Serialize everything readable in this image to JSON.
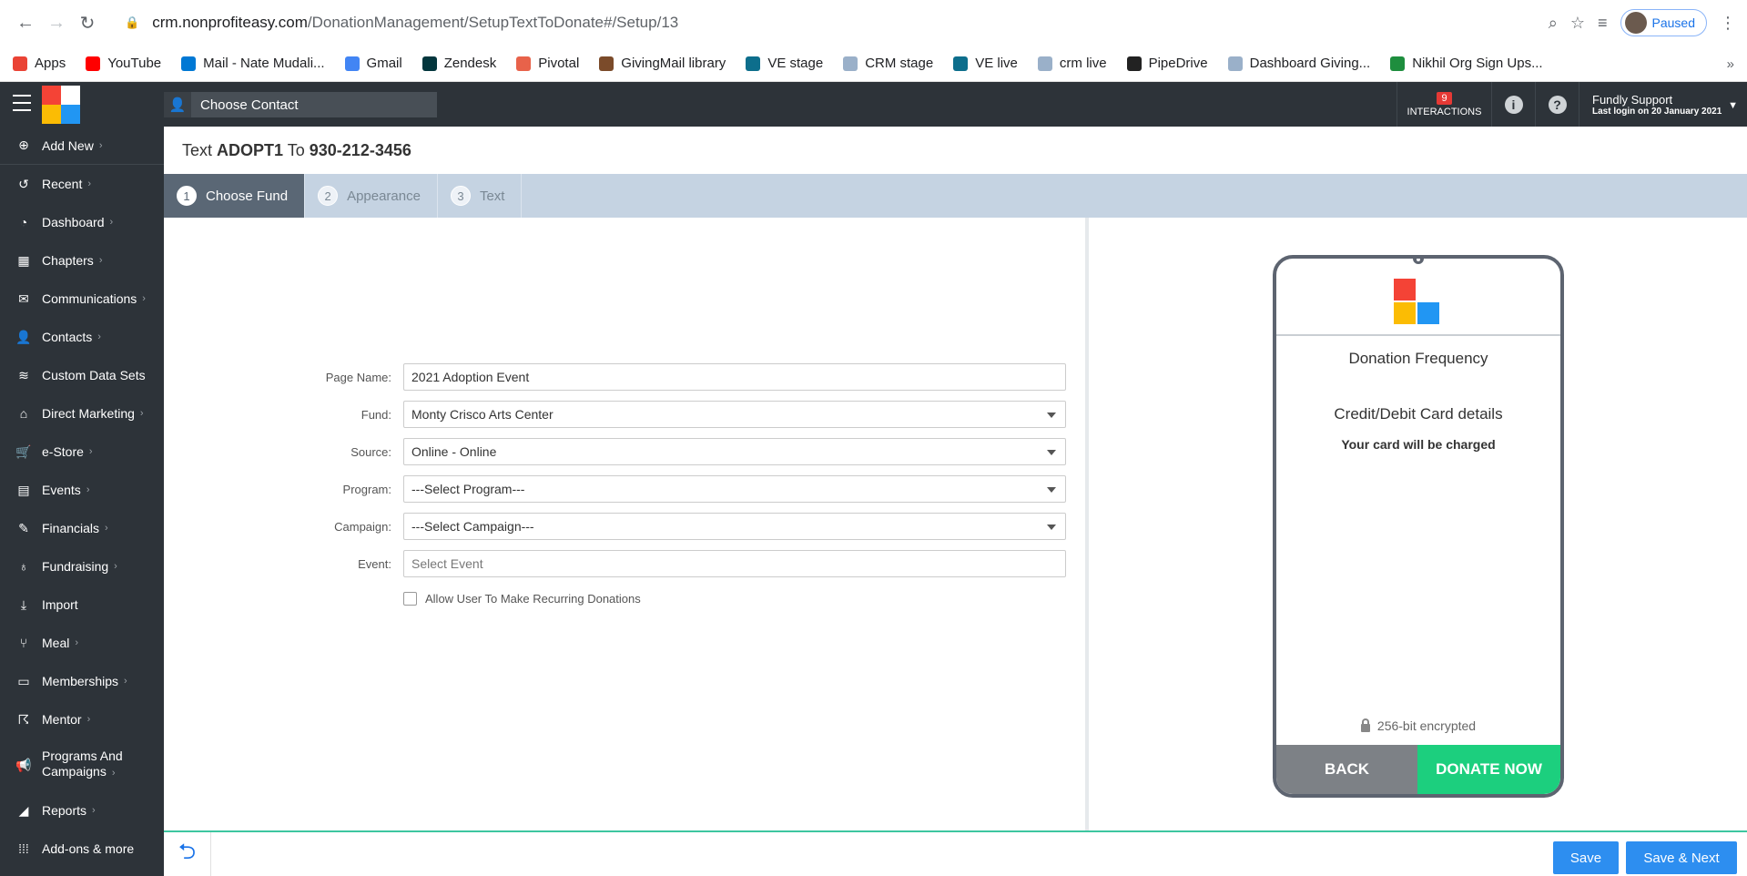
{
  "browser": {
    "url_host": "crm.nonprofiteasy.com",
    "url_path": "/DonationManagement/SetupTextToDonate#/Setup/13",
    "profile_status": "Paused"
  },
  "bookmarks": [
    {
      "label": "Apps",
      "color": "#ea4335"
    },
    {
      "label": "YouTube",
      "color": "#ff0000"
    },
    {
      "label": "Mail - Nate Mudali...",
      "color": "#0078d4"
    },
    {
      "label": "Gmail",
      "color": "#4285f4"
    },
    {
      "label": "Zendesk",
      "color": "#03363d"
    },
    {
      "label": "Pivotal",
      "color": "#e8624a"
    },
    {
      "label": "GivingMail library",
      "color": "#7b4b2a"
    },
    {
      "label": "VE stage",
      "color": "#0d6e8c"
    },
    {
      "label": "CRM stage",
      "color": "#9ab0c9"
    },
    {
      "label": "VE live",
      "color": "#0d6e8c"
    },
    {
      "label": "crm live",
      "color": "#9ab0c9"
    },
    {
      "label": "PipeDrive",
      "color": "#222222"
    },
    {
      "label": "Dashboard Giving...",
      "color": "#9ab0c9"
    },
    {
      "label": "Nikhil Org Sign Ups...",
      "color": "#1e8e3e"
    }
  ],
  "header": {
    "choose_contact": "Choose Contact",
    "interactions_count": "9",
    "interactions_label": "INTERACTIONS",
    "user_name": "Fundly Support",
    "last_login": "Last login on 20 January 2021"
  },
  "sidebar": {
    "items": [
      {
        "label": "Add New",
        "icon": "plus-circle-icon",
        "glyph": "⊕",
        "chevron": "›"
      },
      {
        "label": "Recent",
        "icon": "history-icon",
        "glyph": "↺",
        "chevron": "›"
      },
      {
        "label": "Dashboard",
        "icon": "dashboard-icon",
        "glyph": "◔",
        "chevron": "›"
      },
      {
        "label": "Chapters",
        "icon": "grid-icon",
        "glyph": "▦",
        "chevron": "›"
      },
      {
        "label": "Communications",
        "icon": "envelope-icon",
        "glyph": "✉",
        "chevron": "›"
      },
      {
        "label": "Contacts",
        "icon": "user-icon",
        "glyph": "👤",
        "chevron": "›"
      },
      {
        "label": "Custom Data Sets",
        "icon": "layers-icon",
        "glyph": "≋",
        "chevron": ""
      },
      {
        "label": "Direct Marketing",
        "icon": "bank-icon",
        "glyph": "⌂",
        "chevron": "›"
      },
      {
        "label": "e-Store",
        "icon": "cart-icon",
        "glyph": "🛒",
        "chevron": "›"
      },
      {
        "label": "Events",
        "icon": "calendar-icon",
        "glyph": "▤",
        "chevron": "›"
      },
      {
        "label": "Financials",
        "icon": "money-icon",
        "glyph": "✎",
        "chevron": "›"
      },
      {
        "label": "Fundraising",
        "icon": "moneybag-icon",
        "glyph": "♁",
        "chevron": "›"
      },
      {
        "label": "Import",
        "icon": "import-icon",
        "glyph": "⤓",
        "chevron": ""
      },
      {
        "label": "Meal",
        "icon": "utensils-icon",
        "glyph": "⑂",
        "chevron": "›"
      },
      {
        "label": "Memberships",
        "icon": "id-card-icon",
        "glyph": "▭",
        "chevron": "›"
      },
      {
        "label": "Mentor",
        "icon": "mentor-icon",
        "glyph": "☈",
        "chevron": "›"
      },
      {
        "label": "Programs And",
        "label2": "Campaigns",
        "icon": "megaphone-icon",
        "glyph": "📢",
        "chevron": "›"
      },
      {
        "label": "Reports",
        "icon": "chart-icon",
        "glyph": "◢",
        "chevron": "›"
      },
      {
        "label": "Add-ons & more",
        "icon": "apps-grid-icon",
        "glyph": "⁞⁞⁞",
        "chevron": ""
      }
    ]
  },
  "page": {
    "title_prefix": "Text",
    "keyword": "ADOPT1",
    "title_mid": "To",
    "phone_number": "930-212-3456"
  },
  "steps": [
    {
      "num": "1",
      "label": "Choose Fund",
      "active": true
    },
    {
      "num": "2",
      "label": "Appearance",
      "active": false
    },
    {
      "num": "3",
      "label": "Text",
      "active": false
    }
  ],
  "form": {
    "page_name": {
      "label": "Page Name:",
      "value": "2021 Adoption Event"
    },
    "fund": {
      "label": "Fund:",
      "value": "Monty Crisco Arts Center"
    },
    "source": {
      "label": "Source:",
      "value": "Online - Online"
    },
    "program": {
      "label": "Program:",
      "value": "---Select Program---"
    },
    "campaign": {
      "label": "Campaign:",
      "value": "---Select Campaign---"
    },
    "event": {
      "label": "Event:",
      "placeholder": "Select Event"
    },
    "recurring": {
      "label": "Allow User To Make Recurring Donations",
      "checked": false
    }
  },
  "preview": {
    "frequency_title": "Donation Frequency",
    "card_title": "Credit/Debit Card details",
    "card_note": "Your card will be charged",
    "encrypted": "256-bit encrypted",
    "back_label": "BACK",
    "donate_label": "DONATE NOW"
  },
  "footer": {
    "save_label": "Save",
    "save_next_label": "Save & Next"
  },
  "colors": {
    "accent_blue": "#2d8ef0",
    "donate_green": "#1ccf7e",
    "sidebar_bg": "#2d3339",
    "step_bar": "#c5d3e2"
  }
}
